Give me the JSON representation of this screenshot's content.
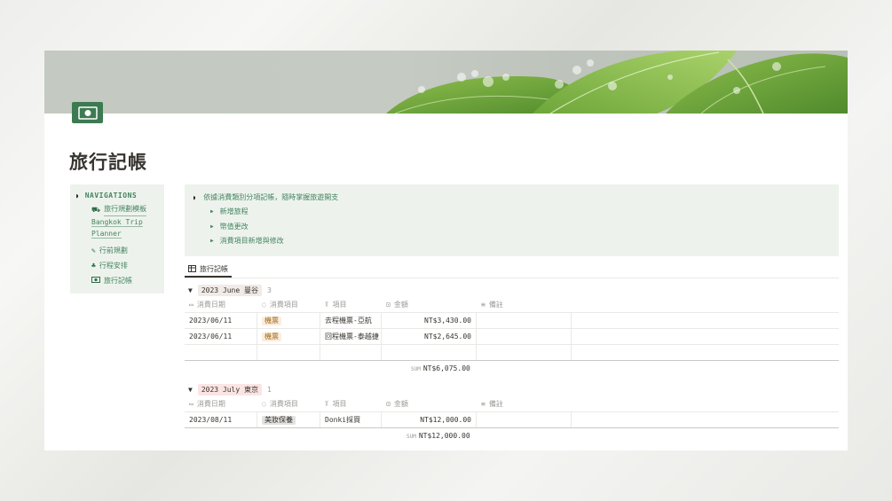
{
  "page": {
    "title": "旅行記帳",
    "icon": "money-icon"
  },
  "sidebar": {
    "heading": "NAVIGATIONS",
    "items": [
      {
        "label": "旅行規劃模板",
        "icon": "map-pin-icon",
        "style": "link"
      },
      {
        "label": "Bangkok Trip Planner",
        "icon": "",
        "style": "link"
      },
      {
        "label": "行前規劃",
        "icon": "pencil-icon"
      },
      {
        "label": "行程安排",
        "icon": "cactus-icon"
      },
      {
        "label": "旅行記帳",
        "icon": "money-icon"
      }
    ]
  },
  "callout": {
    "heading": "依據消費類別分項記帳，隨時掌握旅遊開支",
    "items": [
      "新增旅程",
      "幣值更改",
      "消費項目新增與修改"
    ]
  },
  "database": {
    "view_tab": "旅行記帳",
    "columns": [
      "消費日期",
      "消費項目",
      "項目",
      "金額",
      "備註"
    ],
    "groups": [
      {
        "label": "2023 June 曼谷",
        "count": "3",
        "tag_color": "#f1eae6",
        "rows": [
          {
            "date": "2023/06/11",
            "category": "機票",
            "item": "去程機票-亞航",
            "amount": "NT$3,430.00",
            "note": "",
            "cat_color": "#fbecdd",
            "cat_text": "#9f6b19"
          },
          {
            "date": "2023/06/11",
            "category": "機票",
            "item": "回程機票-泰越捷",
            "amount": "NT$2,645.00",
            "note": "",
            "cat_color": "#fbecdd",
            "cat_text": "#9f6b19"
          },
          {
            "date": "",
            "category": "",
            "item": "",
            "amount": "",
            "note": ""
          }
        ],
        "sum_label": "SUM",
        "sum": "NT$6,075.00"
      },
      {
        "label": "2023 July 東京",
        "count": "1",
        "tag_color": "#fbe4e4",
        "rows": [
          {
            "date": "2023/08/11",
            "category": "美妝保養",
            "item": "Donki採買",
            "amount": "NT$12,000.00",
            "note": "",
            "cat_color": "#e3e2e0",
            "cat_text": "#32302c"
          }
        ],
        "sum_label": "SUM",
        "sum": "NT$12,000.00"
      }
    ]
  },
  "colors": {
    "accent_green": "#448361",
    "callout_bg": "#edf3ec",
    "icon_green": "#3d7a52"
  }
}
